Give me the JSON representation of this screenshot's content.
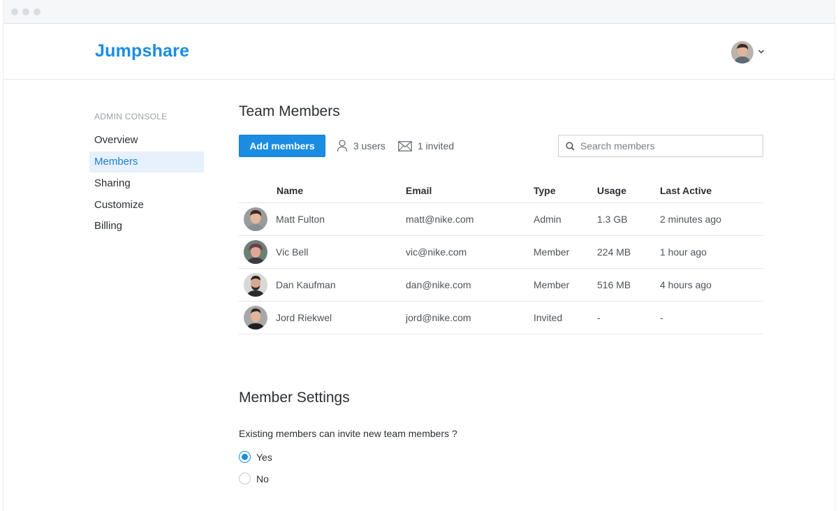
{
  "brand": {
    "name": "Jumpshare",
    "color": "#1a8de3"
  },
  "header": {
    "user_avatar_icon": "user-avatar",
    "menu_icon": "chevron-down-icon"
  },
  "sidebar": {
    "heading": "ADMIN CONSOLE",
    "items": [
      {
        "label": "Overview",
        "active": false
      },
      {
        "label": "Members",
        "active": true
      },
      {
        "label": "Sharing",
        "active": false
      },
      {
        "label": "Customize",
        "active": false
      },
      {
        "label": "Billing",
        "active": false
      }
    ]
  },
  "team": {
    "title": "Team Members",
    "add_button": "Add members",
    "users_count": "3 users",
    "invited_count": "1 invited",
    "search_placeholder": "Search members"
  },
  "table": {
    "columns": [
      "Name",
      "Email",
      "Type",
      "Usage",
      "Last Active"
    ],
    "rows": [
      {
        "name": "Matt Fulton",
        "email": "matt@nike.com",
        "type": "Admin",
        "usage": "1.3 GB",
        "last_active": "2 minutes ago"
      },
      {
        "name": "Vic Bell",
        "email": "vic@nike.com",
        "type": "Member",
        "usage": "224 MB",
        "last_active": "1 hour ago"
      },
      {
        "name": "Dan Kaufman",
        "email": "dan@nike.com",
        "type": "Member",
        "usage": "516 MB",
        "last_active": "4 hours ago"
      },
      {
        "name": "Jord Riekwel",
        "email": "jord@nike.com",
        "type": "Invited",
        "usage": "-",
        "last_active": "-"
      }
    ]
  },
  "member_settings": {
    "title": "Member Settings",
    "question": "Existing members can invite new team members ?",
    "options": [
      {
        "label": "Yes",
        "selected": true
      },
      {
        "label": "No",
        "selected": false
      }
    ]
  }
}
